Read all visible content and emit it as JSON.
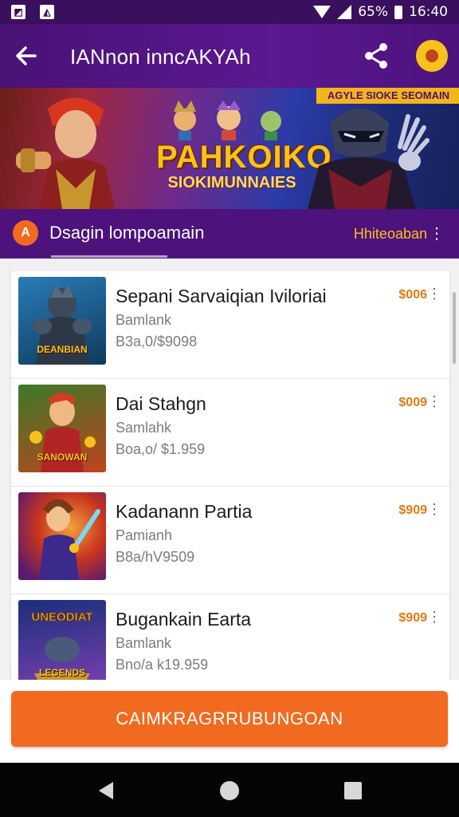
{
  "status_bar": {
    "battery_percent": "65%",
    "time": "16:40",
    "icons": [
      "notification-icon",
      "photo-icon",
      "wifi-icon",
      "signal-icon",
      "battery-icon"
    ]
  },
  "app_bar": {
    "title": "IANnon innсAKYAh",
    "icons": [
      "back-arrow-icon",
      "share-icon",
      "badge-icon"
    ]
  },
  "banner": {
    "ribbon": "AGYLE SIOKE SEOMAIN",
    "logo_line1": "PAHKOIKO",
    "logo_line2": "SIOKIMUNNAIES"
  },
  "section": {
    "icon_text": "A",
    "title": "Dsagin lompoamain",
    "link": "Hhiteoaban",
    "more": "⋮"
  },
  "items": [
    {
      "title": "Sepani Sarvaiqian Iviloriai",
      "subtitle": "Bamlank",
      "meta": "B3a,0/$9098",
      "price": "$006",
      "thumb_text": "DEANBIAN",
      "colors": [
        "#0f3b5c",
        "#2a7bb8"
      ]
    },
    {
      "title": "Dai Stahgn",
      "subtitle": "Samlahk",
      "meta": "Boa,o/ $1.959",
      "price": "$009",
      "thumb_text": "SANOWAN",
      "colors": [
        "#3b7a2a",
        "#c0431e"
      ]
    },
    {
      "title": "Kadanann Partia",
      "subtitle": "Pamianh",
      "meta": "B8a/hV9509",
      "price": "$909",
      "thumb_text": "",
      "colors": [
        "#5a1b6e",
        "#c8341f"
      ]
    },
    {
      "title": "Bugankain Earta",
      "subtitle": "Bamlank",
      "meta": "Bno/a k19.959",
      "price": "$909",
      "thumb_text": "LEGENDS",
      "colors": [
        "#1b2f7a",
        "#7a3fb0"
      ]
    }
  ],
  "cta": {
    "label": "CAIMKRAGRRUBUNGOAN"
  },
  "nav": {
    "icons": [
      "nav-back-icon",
      "nav-home-icon",
      "nav-recents-icon"
    ]
  },
  "colors": {
    "primary": "#4d127c",
    "accent": "#f26a1f",
    "gold": "#f7c21b",
    "price": "#e07b12"
  }
}
